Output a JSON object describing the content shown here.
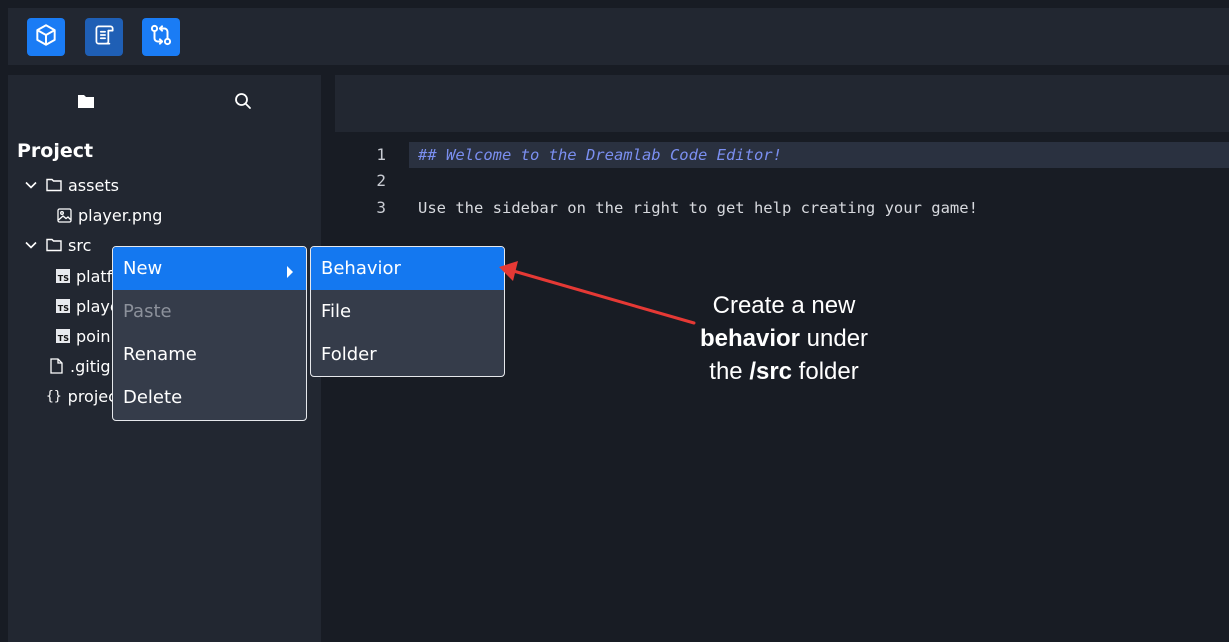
{
  "toolbar": {
    "buttons": [
      {
        "icon": "cube-icon",
        "color": "#1a7cf5"
      },
      {
        "icon": "scroll-icon",
        "color": "#1f5fb5"
      },
      {
        "icon": "git-compare-icon",
        "color": "#1a7cf5"
      }
    ]
  },
  "sidebar": {
    "tabs": [
      {
        "icon": "folder-icon"
      },
      {
        "icon": "search-icon"
      }
    ],
    "title": "Project",
    "tree": [
      {
        "label": "assets",
        "type": "folder",
        "expanded": true
      },
      {
        "label": "player.png",
        "type": "image"
      },
      {
        "label": "src",
        "type": "folder",
        "expanded": true
      },
      {
        "label": "platf",
        "type": "ts",
        "badge": "TS"
      },
      {
        "label": "playe",
        "type": "ts",
        "badge": "TS"
      },
      {
        "label": "poin",
        "type": "ts",
        "badge": "TS"
      },
      {
        "label": ".gitign",
        "type": "file"
      },
      {
        "label": "projec",
        "type": "json",
        "glyph": "{}"
      }
    ]
  },
  "editor": {
    "lines": [
      {
        "number": "1",
        "text": "## Welcome to the Dreamlab Code Editor!"
      },
      {
        "number": "2",
        "text": ""
      },
      {
        "number": "3",
        "text": "Use the sidebar on the right to get help creating your game!"
      }
    ]
  },
  "context_menu": {
    "items": [
      {
        "label": "New",
        "highlighted": true,
        "has_submenu": true
      },
      {
        "label": "Paste",
        "disabled": true
      },
      {
        "label": "Rename"
      },
      {
        "label": "Delete"
      }
    ]
  },
  "submenu": {
    "items": [
      {
        "label": "Behavior",
        "highlighted": true
      },
      {
        "label": "File"
      },
      {
        "label": "Folder"
      }
    ]
  },
  "annotation": {
    "line1": "Create a new",
    "line2_bold": "behavior",
    "line2_rest": " under",
    "line3_pre": "the ",
    "line3_bold": "/src",
    "line3_rest": " folder",
    "arrow_color": "#e53935"
  },
  "colors": {
    "accent": "#1478f0",
    "heading": "#7b8ff0",
    "code_text": "#d7d9de"
  }
}
